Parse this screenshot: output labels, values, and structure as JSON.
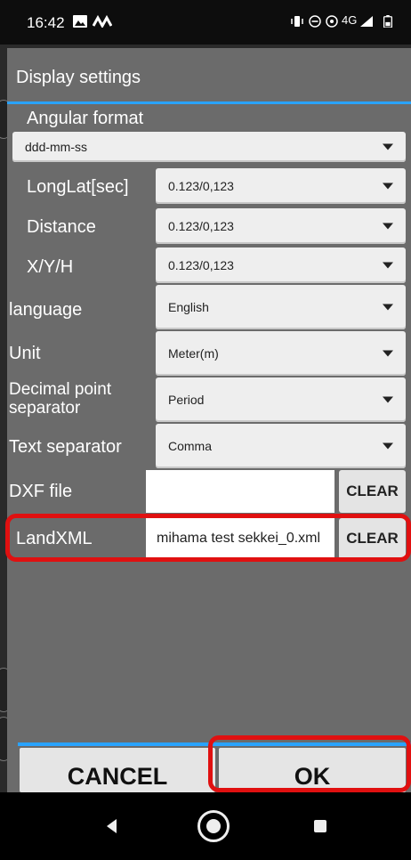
{
  "status_bar": {
    "time": "16:42",
    "network": "4G"
  },
  "dialog": {
    "title": "Display settings",
    "angular_format": {
      "label": "Angular format",
      "value": "ddd-mm-ss"
    },
    "longlat": {
      "label": "LongLat[sec]",
      "value": "0.123/0,123"
    },
    "distance": {
      "label": "Distance",
      "value": "0.123/0,123"
    },
    "xyh": {
      "label": "X/Y/H",
      "value": "0.123/0,123"
    },
    "language": {
      "label": "language",
      "value": "English"
    },
    "unit": {
      "label": "Unit",
      "value": "Meter(m)"
    },
    "decimal_sep": {
      "label": "Decimal point separator",
      "value": "Period"
    },
    "text_sep": {
      "label": "Text separator",
      "value": "Comma"
    },
    "dxf": {
      "label": "DXF file",
      "value": "",
      "clear_label": "CLEAR"
    },
    "landxml": {
      "label": "LandXML",
      "value": "mihama test sekkei_0.xml",
      "clear_label": "CLEAR"
    },
    "cancel_label": "CANCEL",
    "ok_label": "OK"
  },
  "colors": {
    "dialog_bg": "#6b6b6b",
    "accent": "#29a3ff",
    "highlight": "#e01010"
  }
}
